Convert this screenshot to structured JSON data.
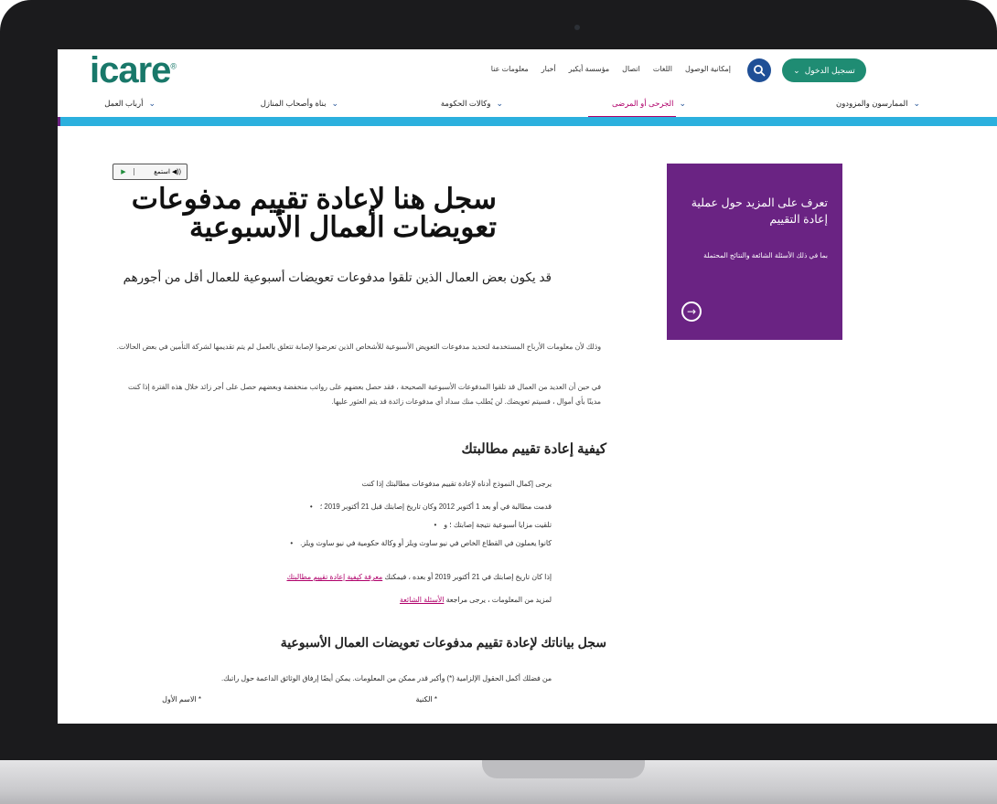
{
  "header": {
    "logo": "icare",
    "login_label": "تسجيل الدخول",
    "top_links": [
      "إمكانية الوصول",
      "اللغات",
      "اتصال",
      "مؤسسة أيكير",
      "أخبار",
      "معلومات عنا"
    ],
    "main_nav": [
      {
        "label": "الممارسون والمزودون",
        "active": false
      },
      {
        "label": "الجرحى أو المرضى",
        "active": true
      },
      {
        "label": "وكالات الحكومة",
        "active": false
      },
      {
        "label": "بناة وأصحاب المنازل",
        "active": false
      },
      {
        "label": "أرباب العمل",
        "active": false
      }
    ]
  },
  "listen_label": "استمع",
  "page": {
    "title": "سجل هنا لإعادة تقييم مدفوعات تعويضات العمال الأسبوعية",
    "subtitle": "قد يكون بعض العمال الذين تلقوا مدفوعات تعويضات أسبوعية للعمال أقل من أجورهم",
    "para1": "وذلك لأن معلومات الأرباح المستخدمة لتحديد مدفوعات التعويض الأسبوعية للأشخاص الذين تعرضوا لإصابة تتعلق بالعمل لم يتم تقديمها لشركة التأمين في بعض الحالات.",
    "para2": "في حين أن العديد من العمال قد تلقوا المدفوعات الأسبوعية الصحيحة ، فقد حصل بعضهم على رواتب منخفضة وبعضهم حصل على أجر زائد خلال هذه الفترة إذا كنت مدينًا بأي أموال ، فسيتم تعويضك. لن يُطلب منك سداد أي مدفوعات زائدة قد يتم العثور عليها.",
    "section1_heading": "كيفية إعادة تقييم مطالبتك",
    "section1_intro": "يرجى إكمال النموذج أدناه لإعادة تقييم مدفوعات مطالبتك إذا كنت",
    "bullets": [
      "قدمت مطالبة في أو بعد 1 أكتوبر 2012 وكان تاريخ إصابتك قبل 21 أكتوبر 2019 ؛",
      "تلقيت مزايا أسبوعية نتيجة إصابتك ؛ و",
      "كانوا يعملون في القطاع الخاص في نيو ساوث ويلز أو وكالة حكومية في نيو ساوث ويلز."
    ],
    "after_oct_text": "إذا كان تاريخ إصابتك في 21 أكتوبر 2019 أو بعده ، فيمكنك",
    "after_oct_link": "معرفة كيفية إعادة تقييم مطالبتك",
    "faq_text": "لمزيد من المعلومات ، يرجى مراجعة",
    "faq_link": "الأسئلة الشائعة",
    "section2_heading": "سجل بياناتك لإعادة تقييم مدفوعات تعويضات العمال الأسبوعية",
    "section2_intro": "من فضلك أكمل الحقول الإلزامية (*) وأكبر قدر ممكن من المعلومات. يمكن أيضًا إرفاق الوثائق الداعمة حول راتبك.",
    "field_surname": "* الكنية",
    "field_firstname": "* الاسم الأول"
  },
  "promo": {
    "title": "تعرف على المزيد حول عملية إعادة التقييم",
    "text": "بما في ذلك الأسئلة الشائعة والنتائج المحتملة"
  },
  "colors": {
    "brand_green": "#19786a",
    "accent_magenta": "#b0006a",
    "promo_purple": "#6a2383",
    "nav_blue": "#2bb0de"
  }
}
